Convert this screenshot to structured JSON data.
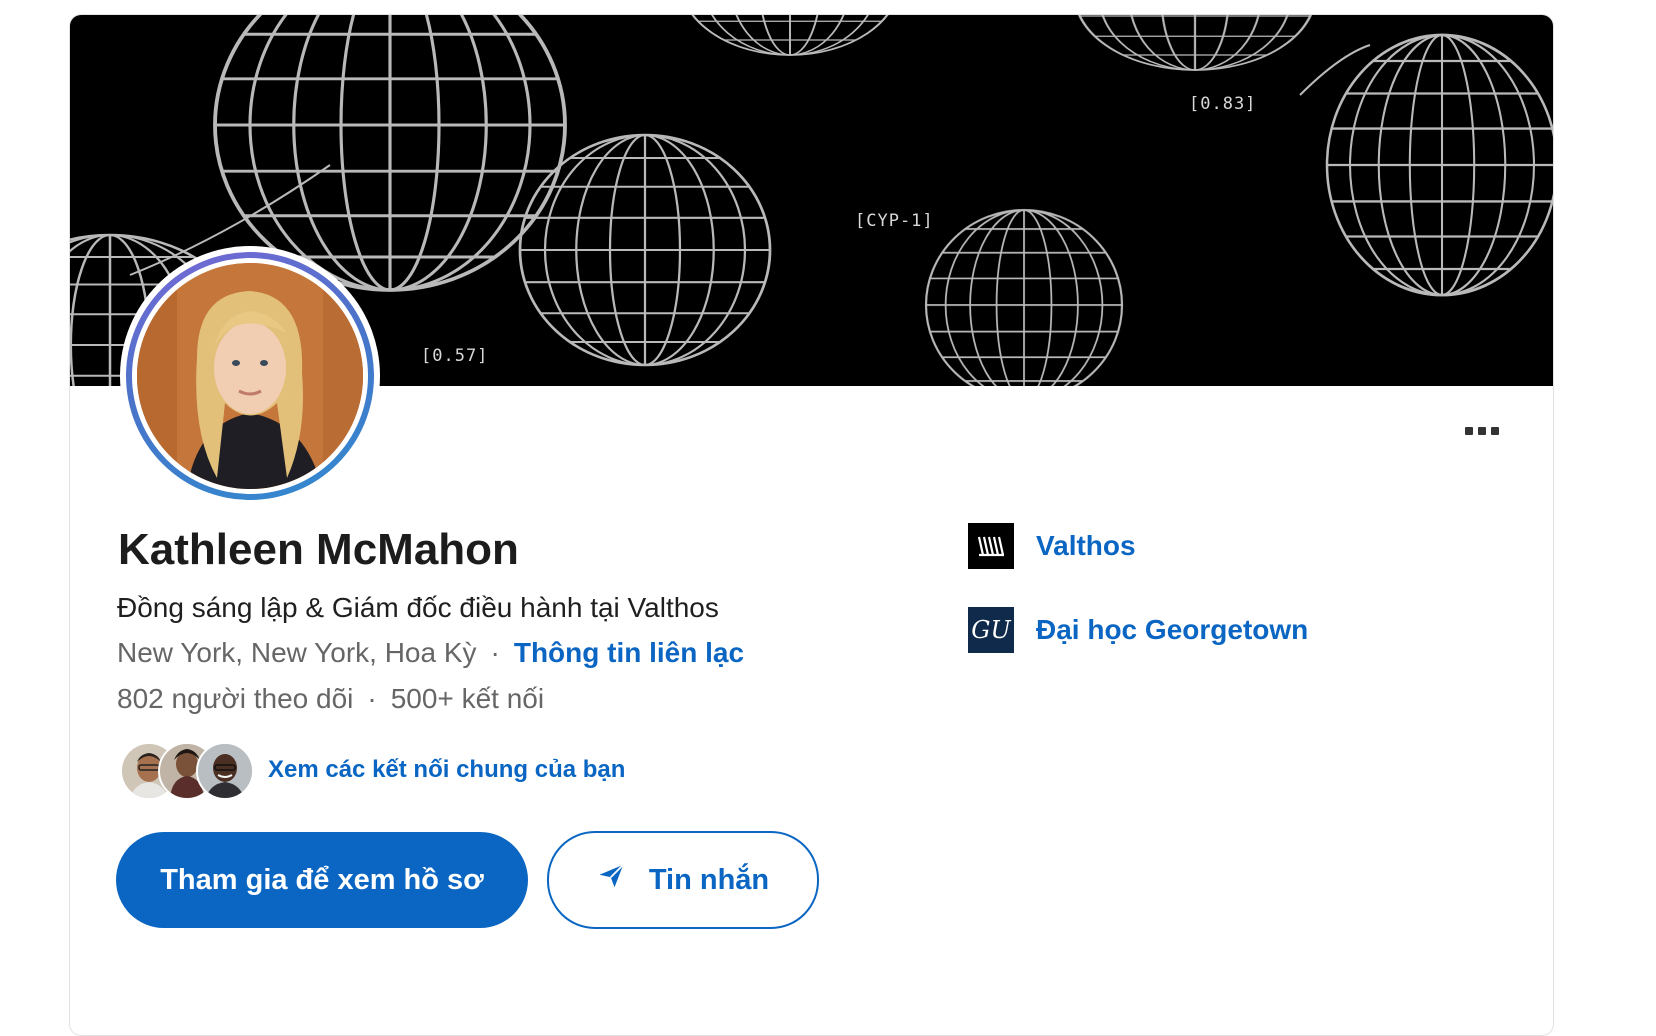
{
  "banner": {
    "tags": [
      "[0.57]",
      "[CYP-1]",
      "[0.83]"
    ]
  },
  "profile": {
    "name": "Kathleen McMahon",
    "headline": "Đồng sáng lập & Giám đốc điều hành tại Valthos",
    "location": "New York, New York, Hoa Kỳ",
    "contact_label": "Thông tin liên lạc",
    "followers": "802 người theo dõi",
    "connections": "500+ kết nối",
    "separator": "·"
  },
  "mutual": {
    "link_label": "Xem các kết nối chung của bạn"
  },
  "actions": {
    "join_label": "Tham gia để xem hồ sơ",
    "message_label": "Tin nhắn"
  },
  "sidebar": {
    "company": {
      "label": "Valthos",
      "logo_text": "W"
    },
    "school": {
      "label": "Đại học Georgetown",
      "logo_text": "GU"
    }
  },
  "colors": {
    "accent": "#0a66c2",
    "banner_bg": "#000000",
    "muted_text": "#666666",
    "school_logo_bg": "#0f2a4a"
  }
}
